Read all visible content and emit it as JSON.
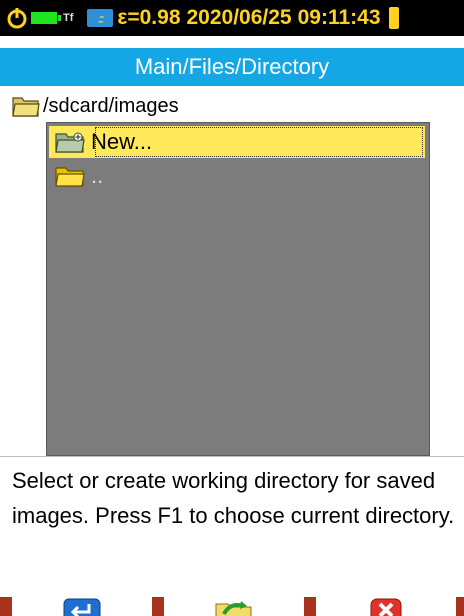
{
  "status": {
    "power_icon": "power-icon",
    "battery_icon": "battery-icon",
    "tf_label": "Tf",
    "card_icon": "sd-card-icon",
    "emissivity": "ε=0.98",
    "date": "2020/06/25",
    "time": "09:11:43",
    "colors": {
      "bar": "#000000",
      "text": "#ffd21f",
      "battery": "#1fe51f",
      "card": "#2f8fd8"
    }
  },
  "title": "Main/Files/Directory",
  "current_path": "/sdcard/images",
  "file_list": {
    "items": [
      {
        "label": "New...",
        "icon": "new-folder-icon",
        "selected": true
      },
      {
        "label": "..",
        "icon": "parent-folder-icon",
        "selected": false
      }
    ],
    "colors": {
      "background": "#7c7c7c",
      "selection": "#ffe85a"
    }
  },
  "help_text": "Select or create working directory for saved images. Press F1 to choose current directory.",
  "function_keys": [
    {
      "key": "F1",
      "icon": "enter-icon"
    },
    {
      "key": "F2",
      "icon": "refresh-folder-icon"
    },
    {
      "key": "F3",
      "icon": "close-icon"
    }
  ],
  "colors": {
    "title_bar": "#15a6e6",
    "fkey_bar": "#a9321e"
  }
}
